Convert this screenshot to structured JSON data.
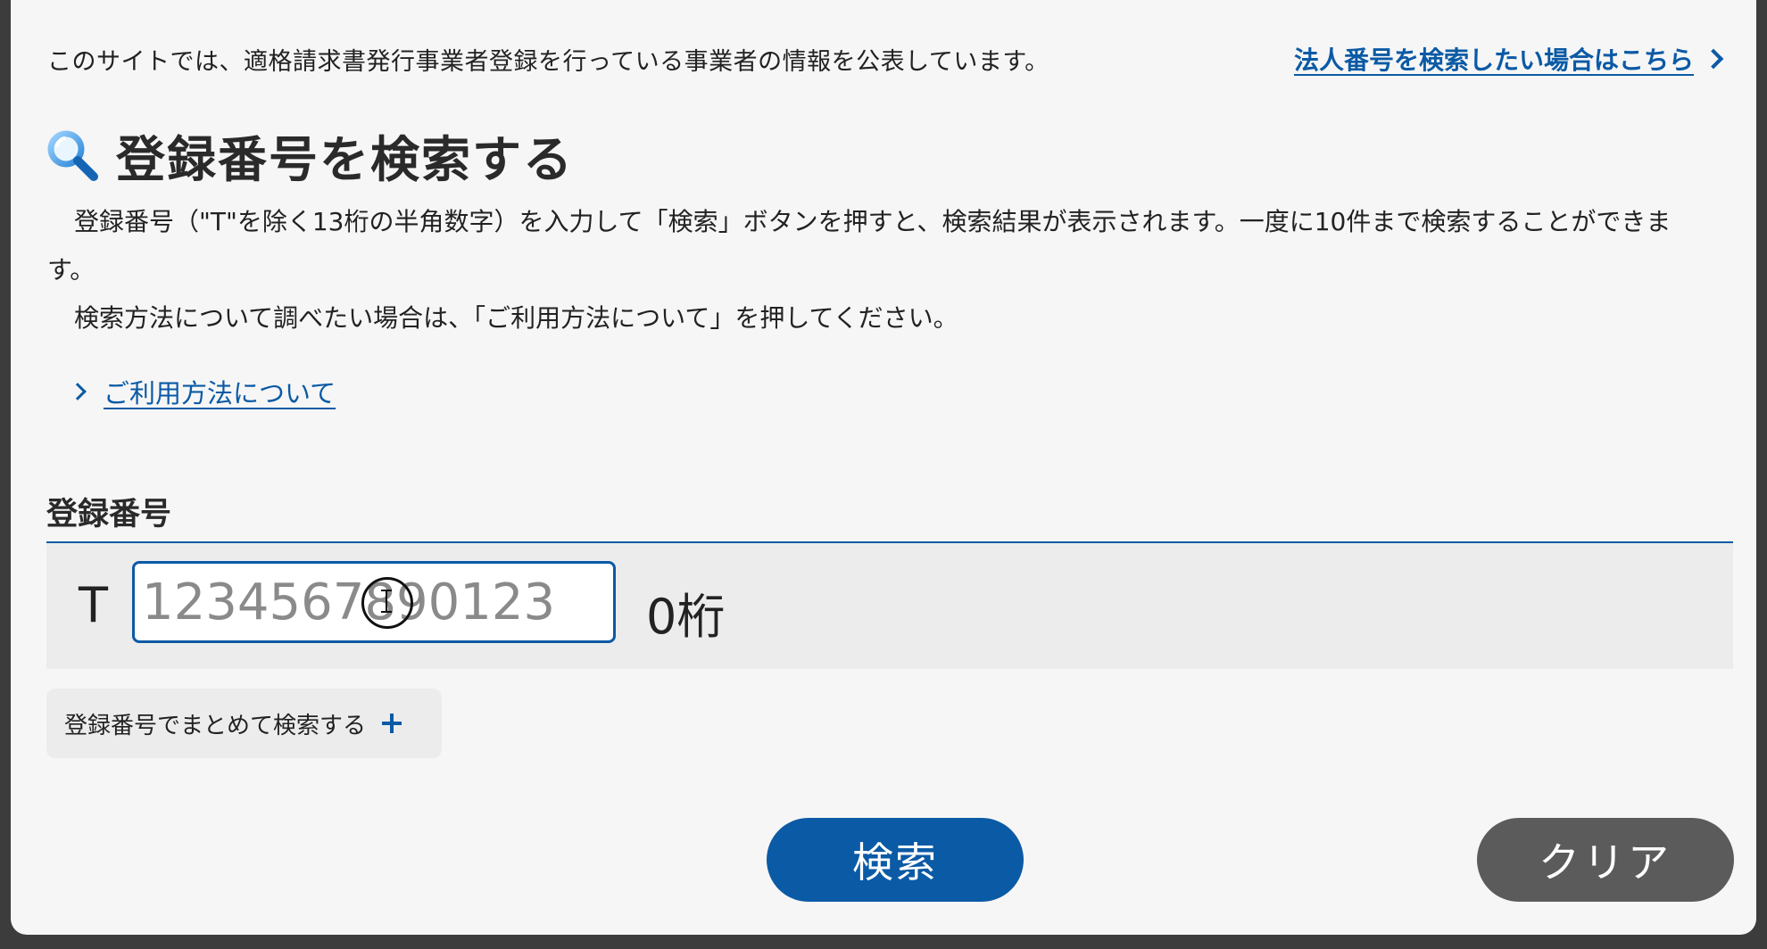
{
  "header": {
    "intro_text": "このサイトでは、適格請求書発行事業者登録を行っている事業者の情報を公表しています。",
    "corp_number_link": "法人番号を検索したい場合はこちら"
  },
  "search_section": {
    "title": "登録番号を検索する",
    "description_1": "登録番号（\"T\"を除く13桁の半角数字）を入力して「検索」ボタンを押すと、検索結果が表示されます。一度に10件まで検索することができます。",
    "description_2": "検索方法について調べたい場合は、「ご利用方法について」を押してください。",
    "usage_link": "ご利用方法について"
  },
  "form": {
    "field_label": "登録番号",
    "prefix": "T",
    "input_placeholder": "1234567890123",
    "input_value": "",
    "digit_count": "0桁",
    "bulk_search_label": "登録番号でまとめて検索する"
  },
  "actions": {
    "search_label": "検索",
    "clear_label": "クリア"
  },
  "colors": {
    "accent": "#0b5aa5",
    "clear_button": "#5b5b5b",
    "panel": "#ececec"
  },
  "icons": {
    "heading_icon": "magnifier-icon",
    "link_chevron": "chevron-right-icon",
    "bulk_plus": "plus-icon"
  }
}
